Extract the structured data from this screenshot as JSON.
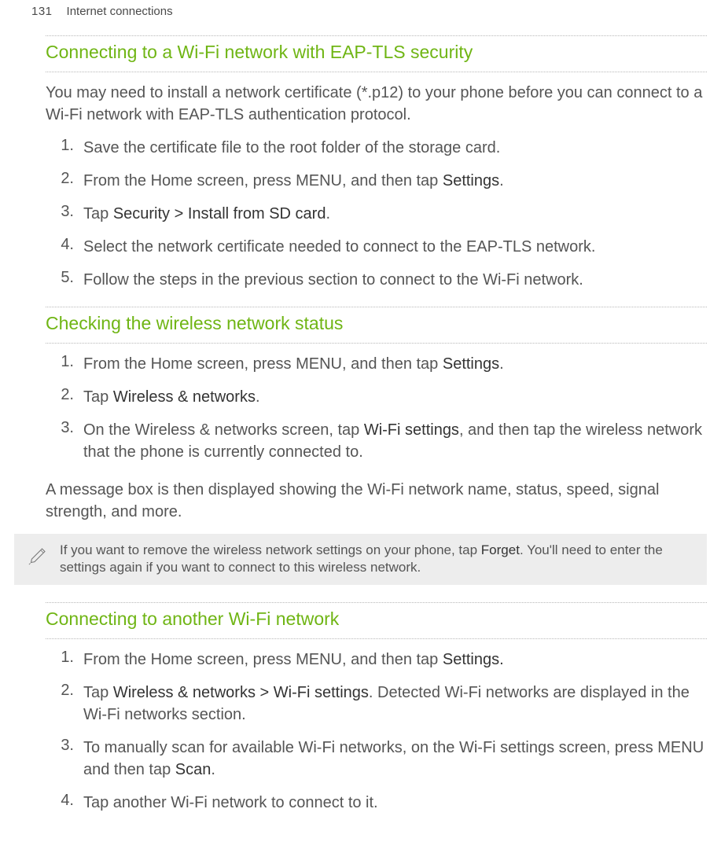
{
  "header": {
    "page_number": "131",
    "chapter": "Internet connections"
  },
  "section1": {
    "heading": "Connecting to a Wi-Fi network with EAP-TLS security",
    "intro": "You may need to install a network certificate (*.p12) to your phone before you can connect to a Wi-Fi network with EAP-TLS authentication protocol.",
    "steps": {
      "s1_num": "1.",
      "s1": "Save the certificate file to the root folder of the storage card.",
      "s2_num": "2.",
      "s2_pre": "From the Home screen, press MENU, and then tap ",
      "s2_bold": "Settings",
      "s2_post": ".",
      "s3_num": "3.",
      "s3_pre": "Tap ",
      "s3_bold": "Security > Install from SD card",
      "s3_post": ".",
      "s4_num": "4.",
      "s4": "Select the network certificate needed to connect to the EAP-TLS network.",
      "s5_num": "5.",
      "s5": "Follow the steps in the previous section to connect to the Wi-Fi network."
    }
  },
  "section2": {
    "heading": "Checking the wireless network status",
    "steps": {
      "s1_num": "1.",
      "s1_pre": "From the Home screen, press MENU, and then tap ",
      "s1_bold": "Settings",
      "s1_post": ".",
      "s2_num": "2.",
      "s2_pre": "Tap ",
      "s2_bold": "Wireless & networks",
      "s2_post": ".",
      "s3_num": "3.",
      "s3_pre": "On the Wireless & networks screen, tap ",
      "s3_bold": "Wi-Fi settings",
      "s3_post": ", and then tap the wireless network that the phone is currently connected to."
    },
    "after": "A message box is then displayed showing the Wi-Fi network name, status, speed, signal strength, and more.",
    "note_pre": "If you want to remove the wireless network settings on your phone, tap ",
    "note_bold": "Forget",
    "note_post": ". You'll need to enter the settings again if you want to connect to this wireless network."
  },
  "section3": {
    "heading": "Connecting to another Wi-Fi network",
    "steps": {
      "s1_num": "1.",
      "s1_pre": "From the Home screen, press MENU, and then tap ",
      "s1_bold": "Settings.",
      "s2_num": "2.",
      "s2_pre": "Tap ",
      "s2_bold": "Wireless & networks > Wi-Fi settings",
      "s2_post": ". Detected Wi-Fi networks are displayed in the Wi-Fi networks section.",
      "s3_num": "3.",
      "s3_pre": "To manually scan for available Wi-Fi networks, on the Wi-Fi settings screen, press MENU and then tap ",
      "s3_bold": "Scan",
      "s3_post": ".",
      "s4_num": "4.",
      "s4": "Tap another Wi-Fi network to connect to it."
    }
  }
}
